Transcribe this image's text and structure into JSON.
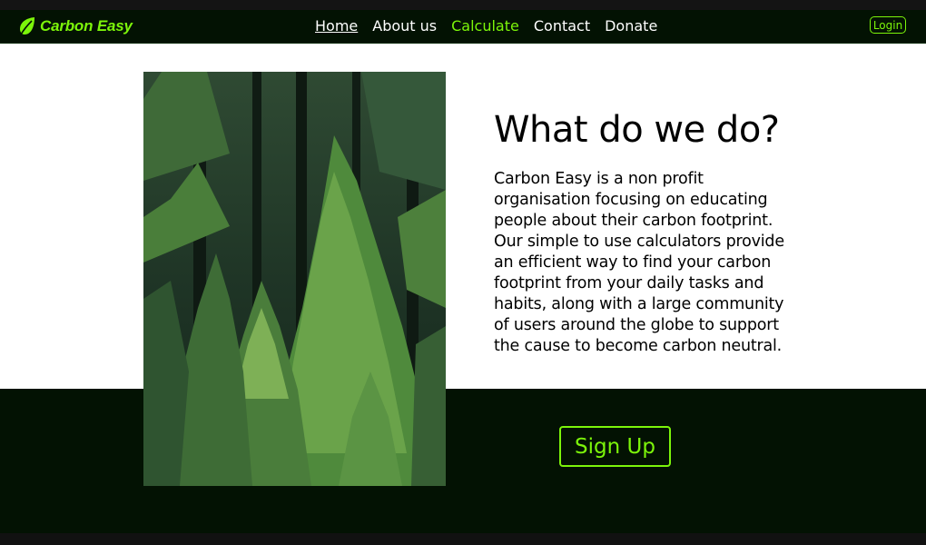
{
  "brand": {
    "name": "Carbon Easy",
    "icon": "leaf-icon",
    "accent_color": "#7cf50a"
  },
  "nav": {
    "links": [
      {
        "label": "Home"
      },
      {
        "label": "About us"
      },
      {
        "label": "Calculate"
      },
      {
        "label": "Contact"
      },
      {
        "label": "Donate"
      }
    ],
    "login_label": "Login"
  },
  "hero": {
    "image": "forest-image",
    "heading": "What do we do?",
    "description": "Carbon Easy is a non profit organisation focusing on educating people about their carbon footprint. Our simple to use calculators provide an efficient way to find your carbon footprint from your daily tasks and habits, along with a large community of users around the globe to support the cause to become carbon neutral."
  },
  "cta": {
    "signup_label": "Sign Up"
  },
  "colors": {
    "nav_background": "#031203",
    "band_background": "#031203",
    "accent": "#7cf50a"
  }
}
